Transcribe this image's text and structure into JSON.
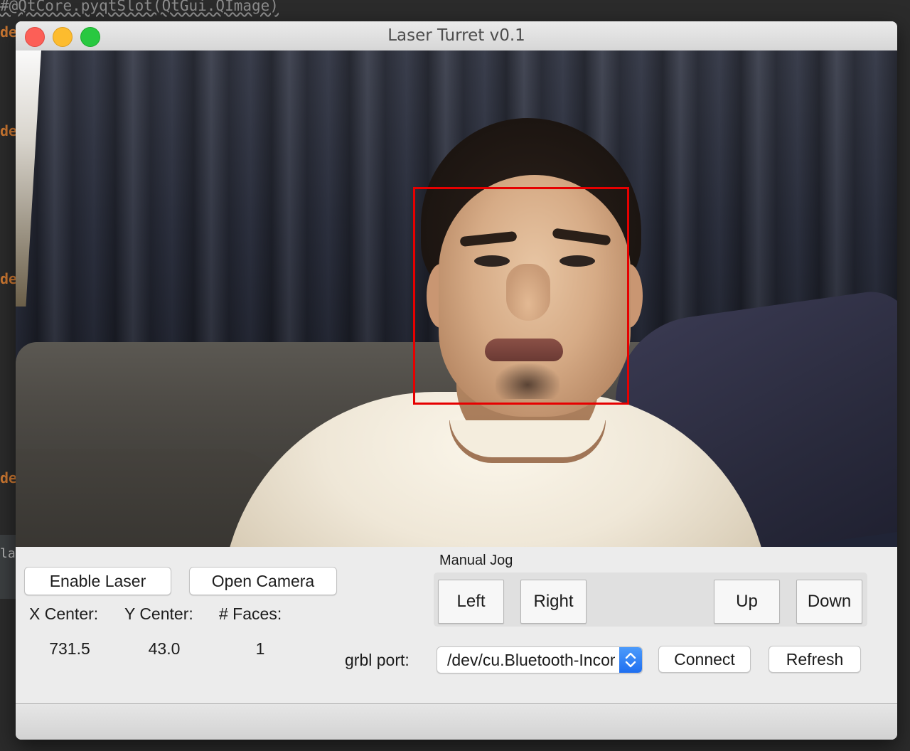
{
  "editor": {
    "code_line": "#@QtCore.pyqtSlot(QtGui.QImage)",
    "keyword": "de",
    "side_text": "lai"
  },
  "window": {
    "title": "Laser Turret v0.1"
  },
  "camera": {
    "face_detected": true
  },
  "buttons": {
    "enable_laser": "Enable Laser",
    "open_camera": "Open Camera",
    "connect": "Connect",
    "refresh": "Refresh"
  },
  "stats": {
    "x_center_label": "X Center:",
    "y_center_label": "Y Center:",
    "faces_label": "# Faces:",
    "x_center_value": "731.5",
    "y_center_value": "43.0",
    "faces_value": "1"
  },
  "jog": {
    "title": "Manual Jog",
    "left": "Left",
    "right": "Right",
    "up": "Up",
    "down": "Down"
  },
  "port": {
    "label": "grbl port:",
    "selected": "/dev/cu.Bluetooth-Incoming-Port"
  },
  "colors": {
    "face_box": "#e60000",
    "combo_accent": "#1f6ff0",
    "window_bg": "#ececec"
  }
}
